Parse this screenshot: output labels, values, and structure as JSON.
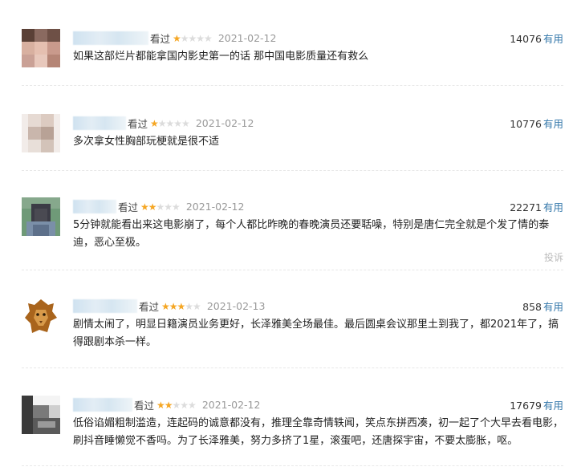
{
  "comments": [
    {
      "watched": "看过",
      "stars_filled": 1,
      "stars_total": 5,
      "date": "2021-02-12",
      "votes": "14076",
      "useful": "有用",
      "text": "如果这部烂片都能拿国内影史第一的话 那中国电影质量还有救么",
      "avatar_colors": [
        "#c99a8c",
        "#8a6a60",
        "#d8b8aa"
      ]
    },
    {
      "watched": "看过",
      "stars_filled": 1,
      "stars_total": 5,
      "date": "2021-02-12",
      "votes": "10776",
      "useful": "有用",
      "text": "多次拿女性胸部玩梗就是很不适",
      "avatar_colors": [
        "#efe7e3",
        "#c9b6ac",
        "#b8a296"
      ]
    },
    {
      "watched": "看过",
      "stars_filled": 2,
      "stars_total": 5,
      "date": "2021-02-12",
      "votes": "22271",
      "useful": "有用",
      "text": "5分钟就能看出来这电影崩了，每个人都比昨晚的春晚演员还要聒噪，特别是唐仁完全就是个发了情的泰迪，恶心至极。",
      "report": "投诉",
      "avatar_colors": [
        "#6f9a78",
        "#3c3c46",
        "#7a8fa8"
      ]
    },
    {
      "watched": "看过",
      "stars_filled": 3,
      "stars_total": 5,
      "date": "2021-02-13",
      "votes": "858",
      "useful": "有用",
      "text": "剧情太闹了，明显日籍演员业务更好，长泽雅美全场最佳。最后圆桌会议那里土到我了，都2021年了，搞得跟剧本杀一样。",
      "avatar_colors": [
        "#ffffff",
        "#a9641c",
        "#6a3a10"
      ]
    },
    {
      "watched": "看过",
      "stars_filled": 2,
      "stars_total": 5,
      "date": "2021-02-12",
      "votes": "17679",
      "useful": "有用",
      "text": "低俗谄媚粗制滥造，连起码的诚意都没有，推理全靠奇情轶闻，笑点东拼西凑，初一起了个大早去看电影，刷抖音睡懒觉不香吗。为了长泽雅美，努力多挤了1星，滚蛋吧，还唐探宇宙，不要太膨胀，呕。",
      "avatar_colors": [
        "#e9e9e9",
        "#5a5a5a",
        "#2a2a2a"
      ]
    }
  ],
  "colors": {
    "star_on": "#f5a623",
    "star_off": "#dcdcdc",
    "useful_link": "#3377aa",
    "date": "#999999"
  }
}
